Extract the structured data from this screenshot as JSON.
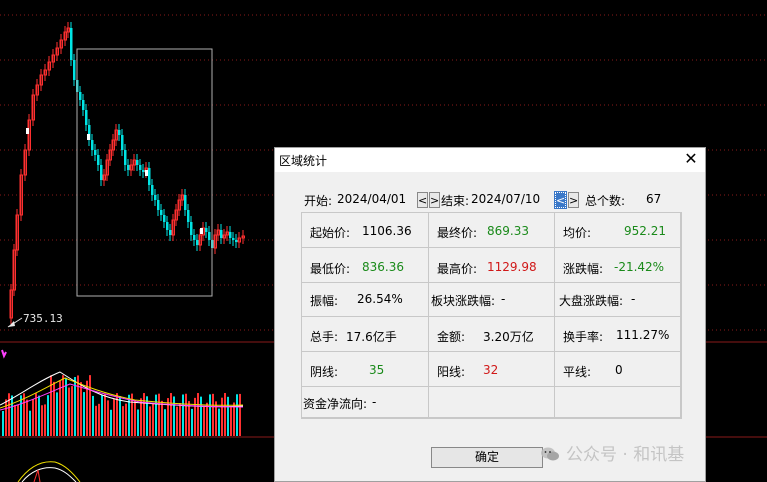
{
  "chart": {
    "low_price_label": "735.13",
    "colors": {
      "up": "#ff3030",
      "down": "#00e5e5",
      "grid": "#8a1a1a",
      "ma_white": "#ffffff",
      "ma_yellow": "#f0e000",
      "ma_magenta": "#ff40ff"
    }
  },
  "dialog": {
    "title": "区域统计",
    "close_icon": "close-icon",
    "start_label": "开始:",
    "start_date": "2024/04/01",
    "prev_label": "<",
    "next_label": ">",
    "end_label": "结束:",
    "end_date": "2024/07/10",
    "total_label": "总个数:",
    "total_value": "67",
    "stats": {
      "open_label": "起始价:",
      "open_value": "1106.36",
      "close_label": "最终价:",
      "close_value": "869.33",
      "avg_label": "均价:",
      "avg_value": "952.21",
      "low_label": "最低价:",
      "low_value": "836.36",
      "high_label": "最高价:",
      "high_value": "1129.98",
      "chg_label": "涨跌幅:",
      "chg_value": "-21.42%",
      "amp_label": "振幅:",
      "amp_value": "26.54%",
      "sector_label": "板块涨跌幅:",
      "sector_value": "-",
      "market_label": "大盘涨跌幅:",
      "market_value": "-",
      "vol_label": "总手:",
      "vol_value": "17.6亿手",
      "amount_label": "金额:",
      "amount_value": "3.20万亿",
      "turnover_label": "换手率:",
      "turnover_value": "111.27%",
      "neg_label": "阴线:",
      "neg_value": "35",
      "pos_label": "阳线:",
      "pos_value": "32",
      "flat_label": "平线:",
      "flat_value": "0",
      "net_label": "资金净流向:",
      "net_value": "-"
    },
    "ok_label": "确定"
  },
  "watermark": {
    "text": "公众号 · 和讯基"
  }
}
